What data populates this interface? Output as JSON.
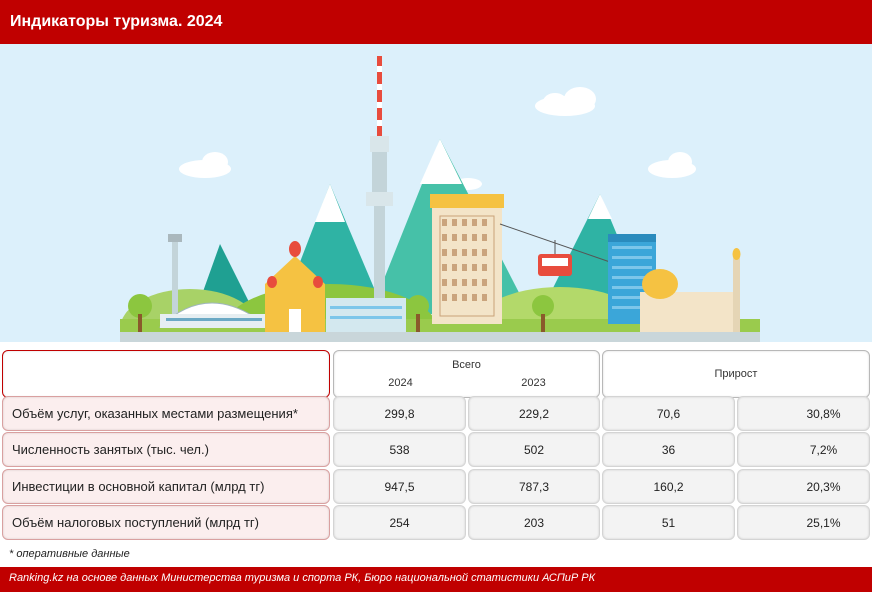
{
  "title": "Индикаторы туризма. 2024",
  "chart_data": {
    "type": "table",
    "title": "Индикаторы туризма. 2024",
    "column_groups": [
      {
        "label": "Всего",
        "columns": [
          "2024",
          "2023"
        ]
      },
      {
        "label": "Прирост",
        "columns": [
          "",
          ""
        ]
      }
    ],
    "rows": [
      {
        "label": "Объём услуг, оказанных местами размещения*",
        "v2024": "299,8",
        "v2023": "229,2",
        "growth_abs": "70,6",
        "growth_pct": "30,8%"
      },
      {
        "label": "Численность занятых (тыс. чел.)",
        "v2024": "538",
        "v2023": "502",
        "growth_abs": "36",
        "growth_pct": "7,2%"
      },
      {
        "label": "Инвестиции в основной капитал (млрд тг)",
        "v2024": "947,5",
        "v2023": "787,3",
        "growth_abs": "160,2",
        "growth_pct": "20,3%"
      },
      {
        "label": "Объём налоговых поступлений (млрд тг)",
        "v2024": "254",
        "v2023": "203",
        "growth_abs": "51",
        "growth_pct": "25,1%"
      }
    ]
  },
  "note": "* оперативные данные",
  "source": "Ranking.kz на основе данных Министерства туризма и спорта РК, Бюро национальной статистики АСПиР РК",
  "colors": {
    "brand": "#c00000",
    "sky": "#dcf0fb"
  }
}
